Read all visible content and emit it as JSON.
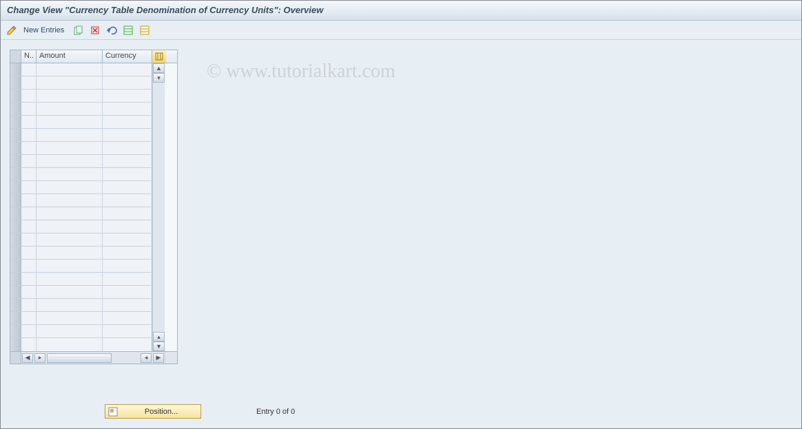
{
  "title": "Change View \"Currency Table Denomination of Currency Units\": Overview",
  "watermark": "© www.tutorialkart.com",
  "toolbar": {
    "new_entries": "New Entries"
  },
  "table": {
    "columns": {
      "n": "N..",
      "amount": "Amount",
      "currency": "Currency"
    },
    "row_count": 22
  },
  "footer": {
    "position_label": "Position...",
    "entry_text": "Entry 0 of 0"
  }
}
